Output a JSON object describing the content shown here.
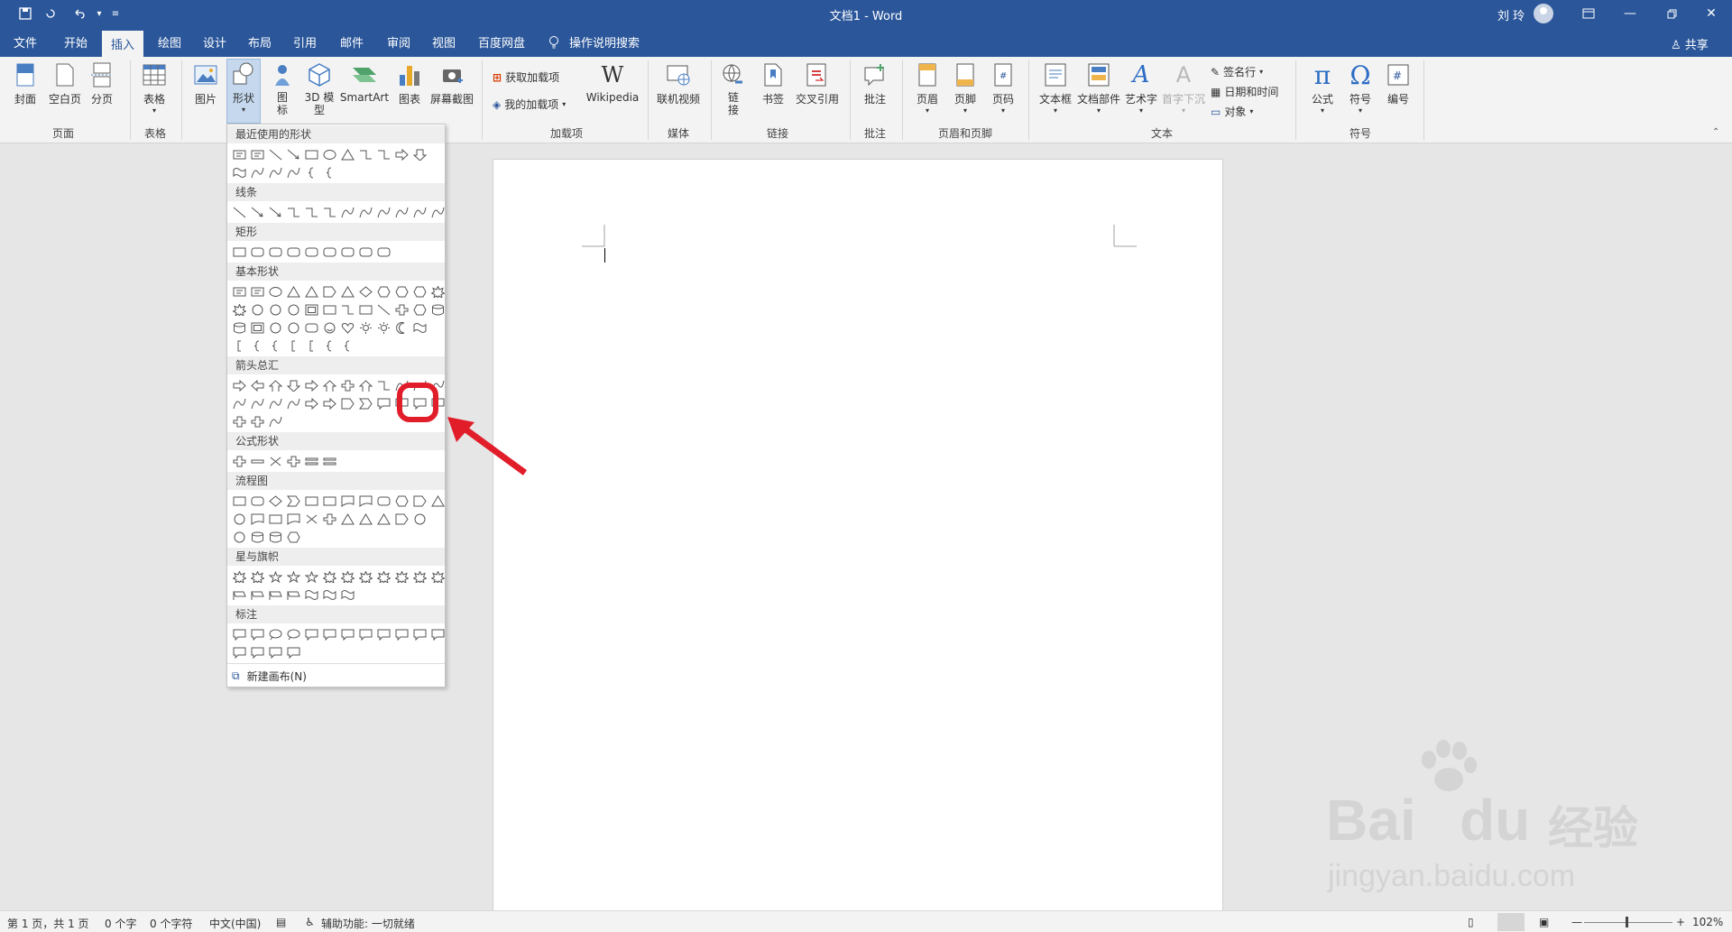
{
  "titlebar": {
    "title": "文档1  -  Word",
    "user": "刘 玲",
    "bg_color": "#2b579a"
  },
  "tabs": [
    "文件",
    "开始",
    "插入",
    "绘图",
    "设计",
    "布局",
    "引用",
    "邮件",
    "审阅",
    "视图",
    "百度网盘"
  ],
  "active_tab": "插入",
  "search_hint": "操作说明搜索",
  "share": "共享",
  "ribbon": {
    "buttons": {
      "cover": "封面",
      "blank_page": "空白页",
      "page_break": "分页",
      "table": "表格",
      "picture": "图片",
      "shapes": "形状",
      "icons": "图\n标",
      "model3d": "3D 模\n型",
      "smartart": "SmartArt",
      "chart": "图表",
      "screenshot": "屏幕截图",
      "get_addins": "获取加载项",
      "my_addins": "我的加载项",
      "wikipedia": "Wikipedia",
      "online_video": "联机视频",
      "link": "链\n接",
      "bookmark": "书签",
      "cross_ref": "交叉引用",
      "comment": "批注",
      "header": "页眉",
      "footer": "页脚",
      "page_number": "页码",
      "textbox": "文本框",
      "doc_parts": "文档部件",
      "wordart": "艺术字",
      "dropcap": "首字下沉",
      "signature": "签名行",
      "datetime": "日期和时间",
      "object": "对象",
      "equation": "公式",
      "symbol": "符号",
      "numbering": "编号"
    },
    "groups": {
      "pages": "页面",
      "tables": "表格",
      "addins": "加载项",
      "media": "媒体",
      "links": "链接",
      "comments": "批注",
      "header_footer": "页眉和页脚",
      "text": "文本",
      "symbols": "符号"
    }
  },
  "shapes_menu": {
    "categories": {
      "recent": "最近使用的形状",
      "lines": "线条",
      "rectangles": "矩形",
      "basic": "基本形状",
      "arrows": "箭头总汇",
      "equation": "公式形状",
      "flowchart": "流程图",
      "stars": "星与旗帜",
      "callouts": "标注"
    },
    "new_canvas": "新建画布(N)"
  },
  "annotation": {
    "color": "#e11d2a"
  },
  "statusbar": {
    "page": "第 1 页，共 1 页",
    "words": "0 个字",
    "chars": "0 个字符",
    "language": "中文(中国)",
    "accessibility": "辅助功能: 一切就绪",
    "zoom": "102%"
  },
  "watermark": {
    "brand": "Bai",
    "brand2": "du",
    "cn": "经验",
    "url": "jingyan.baidu.com"
  }
}
